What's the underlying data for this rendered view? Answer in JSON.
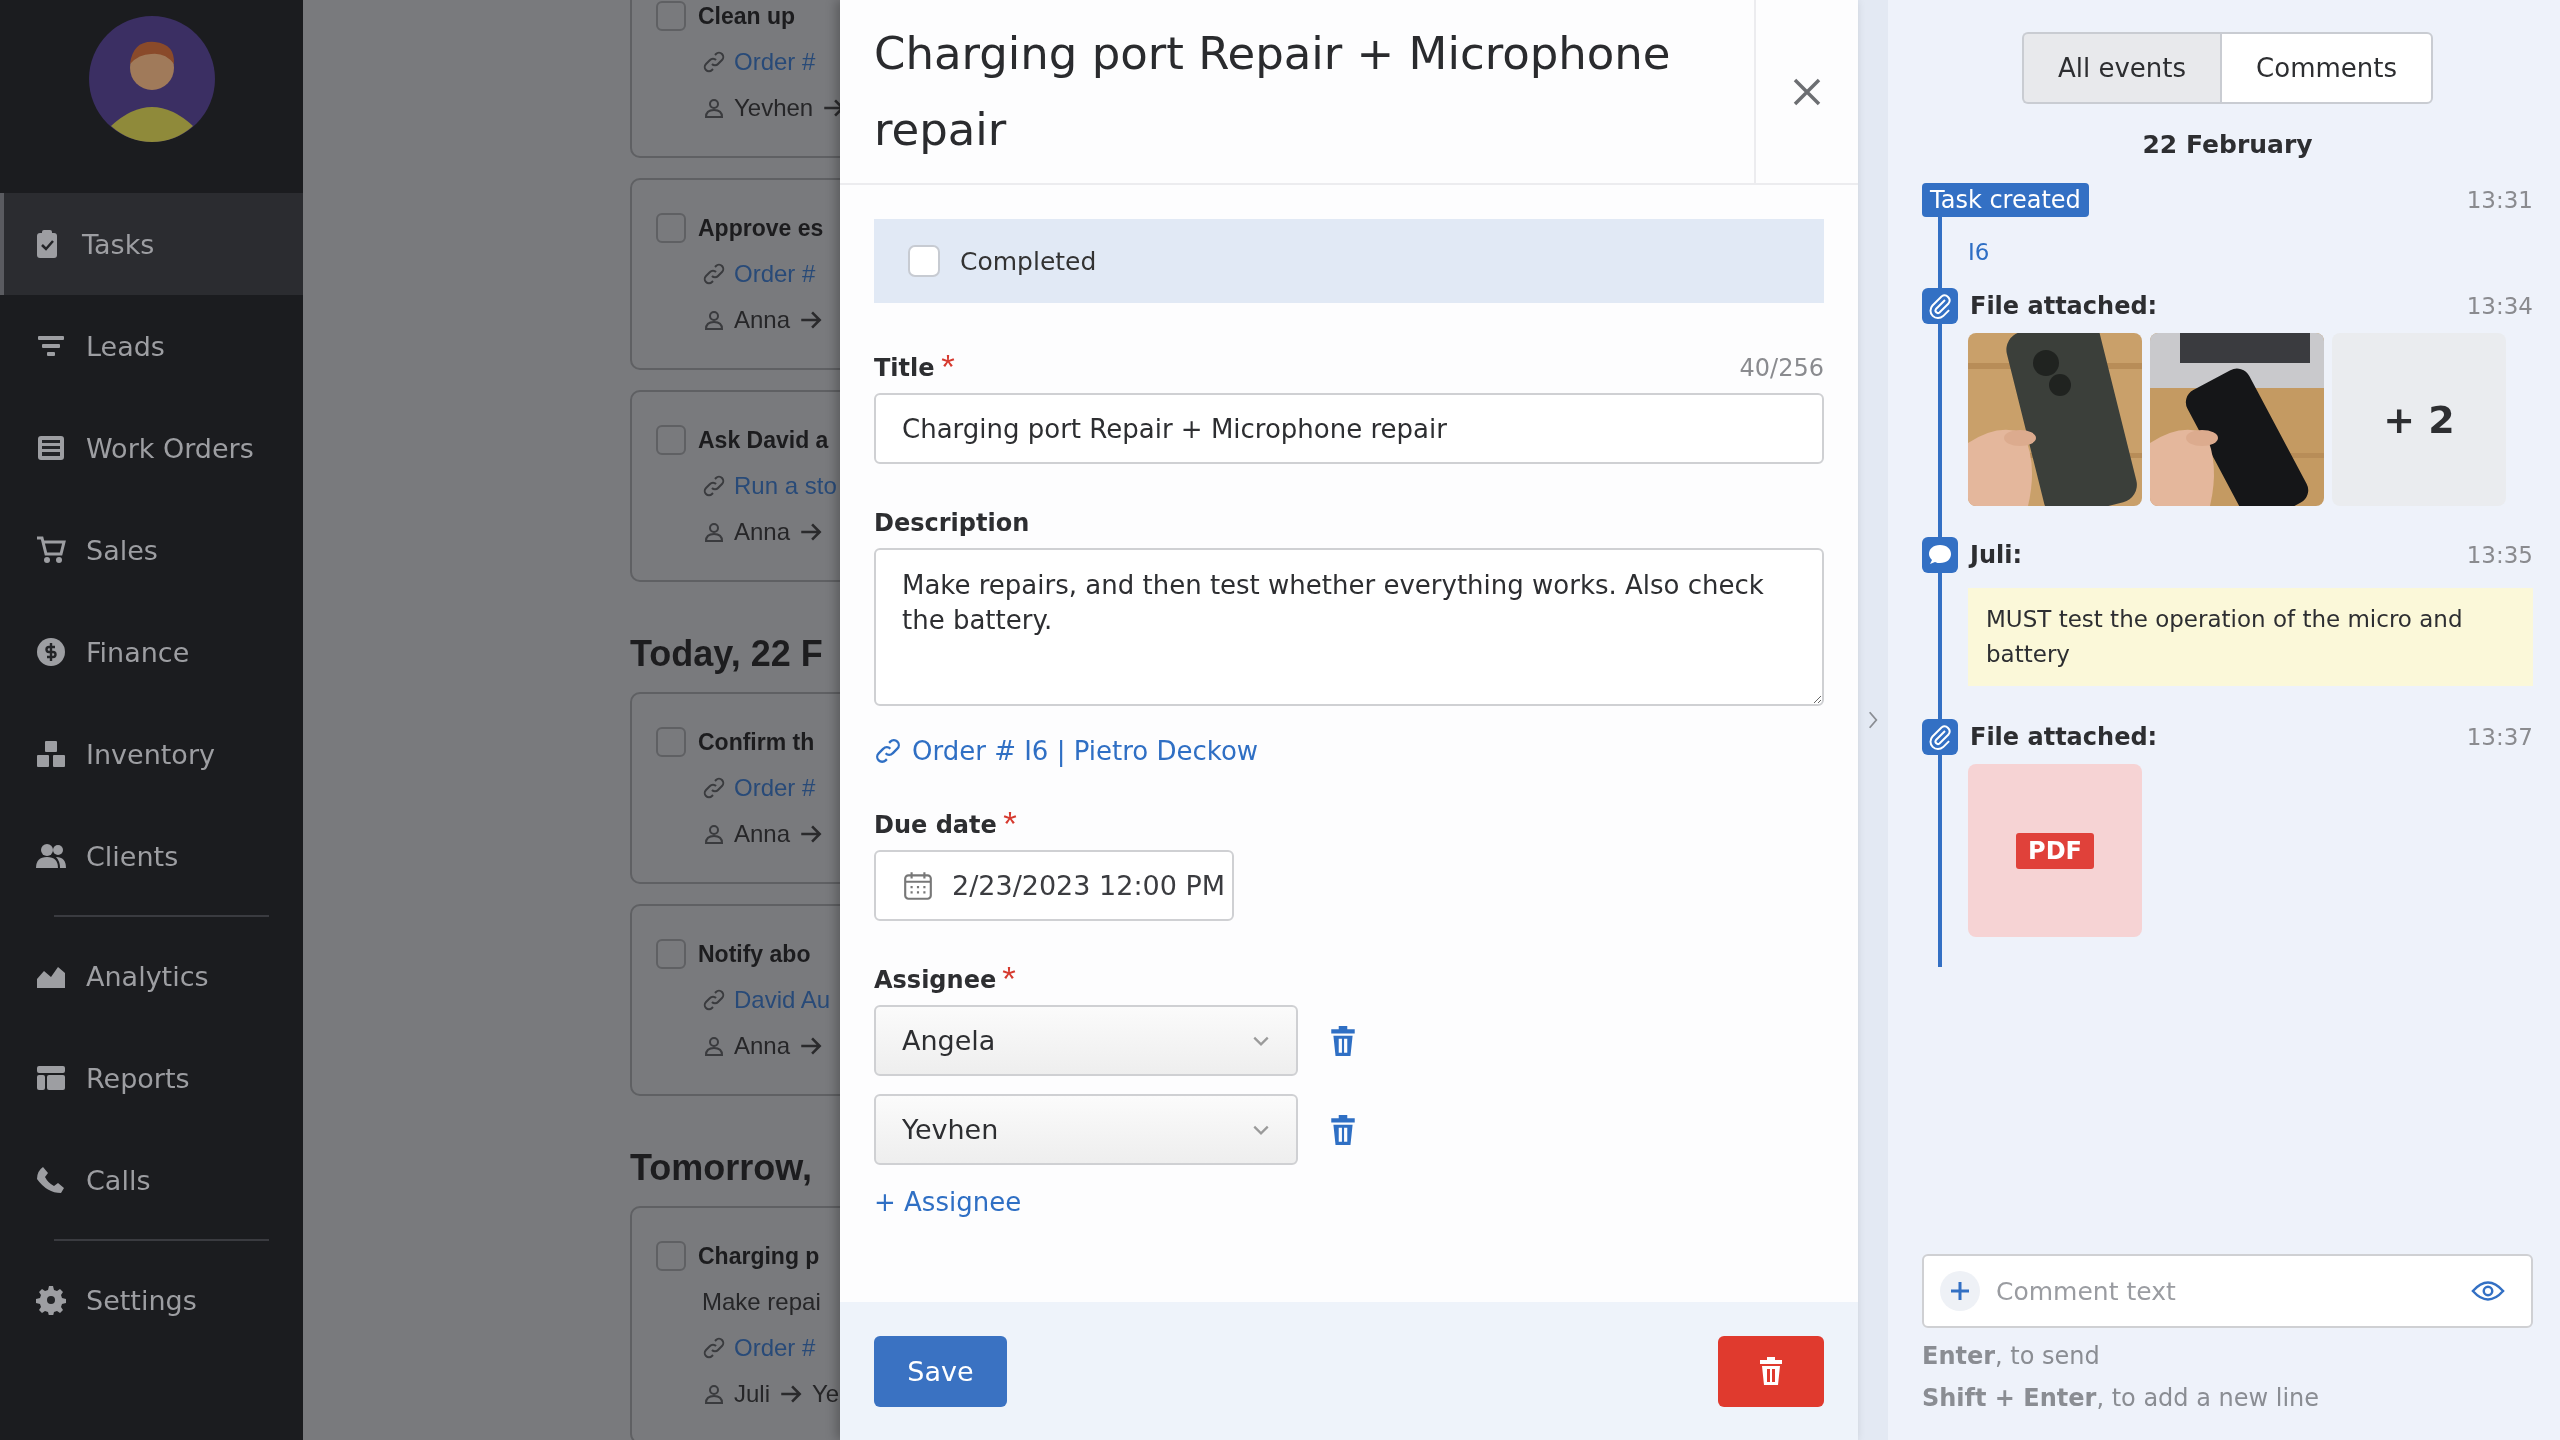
{
  "sidebar": {
    "groups": [
      {
        "items": [
          {
            "label": "Tasks",
            "selected": true
          },
          {
            "label": "Leads",
            "selected": false
          },
          {
            "label": "Work Orders",
            "selected": false
          },
          {
            "label": "Sales",
            "selected": false
          },
          {
            "label": "Finance",
            "selected": false
          },
          {
            "label": "Inventory",
            "selected": false
          },
          {
            "label": "Clients",
            "selected": false
          }
        ]
      },
      {
        "items": [
          {
            "label": "Analytics",
            "selected": false
          },
          {
            "label": "Reports",
            "selected": false
          },
          {
            "label": "Calls",
            "selected": false
          }
        ]
      },
      {
        "items": [
          {
            "label": "Settings",
            "selected": false
          }
        ]
      }
    ]
  },
  "tasks": {
    "sections": [
      {
        "cards": [
          {
            "title": "Clean up",
            "checked": false,
            "link": "Order #",
            "from": "Yevhen"
          },
          {
            "title": "Approve es",
            "checked": false,
            "link": "Order #",
            "from": "Anna"
          },
          {
            "title": "Ask David a",
            "checked": false,
            "link": "Run a sto",
            "from": "Anna"
          }
        ]
      },
      {
        "heading": "Today, 22 F",
        "cards": [
          {
            "title": "Confirm th",
            "checked": false,
            "link": "Order #",
            "from": "Anna"
          },
          {
            "title": "Notify abo",
            "checked": false,
            "link": "David Au",
            "from": "Anna"
          }
        ]
      },
      {
        "heading": "Tomorrow,",
        "cards": [
          {
            "title": "Charging p",
            "checked": false,
            "description": "Make repai",
            "link": "Order #",
            "from": "Juli",
            "to": "Ye"
          }
        ]
      }
    ]
  },
  "modal": {
    "title": "Charging port Repair + Microphone repair",
    "completed": {
      "label": "Completed",
      "checked": false
    },
    "title_field": {
      "label": "Title",
      "required": true,
      "counter": "40/256",
      "value": "Charging port Repair + Microphone repair"
    },
    "description": {
      "label": "Description",
      "value": "Make repairs, and then test whether everything works. Also check the battery."
    },
    "link": "Order # I6 | Pietro Deckow",
    "due_date": {
      "label": "Due date",
      "required": true,
      "value": "2/23/2023 12:00 PM"
    },
    "assignee": {
      "label": "Assignee",
      "required": true,
      "values": [
        "Angela",
        "Yevhen"
      ],
      "add": "+ Assignee"
    },
    "save": "Save"
  },
  "activity": {
    "tabs": [
      {
        "label": "All events",
        "selected": true
      },
      {
        "label": "Comments",
        "selected": false
      }
    ],
    "date": "22 February",
    "events": [
      {
        "kind": "created",
        "badge": "Task created",
        "time": "13:31",
        "link": "I6"
      },
      {
        "kind": "files",
        "label": "File attached:",
        "time": "13:34",
        "more": "+ 2"
      },
      {
        "kind": "comment",
        "author": "Juli:",
        "time": "13:35",
        "text": "MUST test the operation of the micro and battery"
      },
      {
        "kind": "files",
        "label": "File attached:",
        "time": "13:37",
        "files": [
          {
            "kind": "pdf",
            "label": "PDF"
          }
        ]
      }
    ],
    "comment_field": {
      "placeholder": "Comment text"
    },
    "hints": [
      "**Enter**, to send",
      "**Shift + Enter**, to add a new line"
    ]
  }
}
